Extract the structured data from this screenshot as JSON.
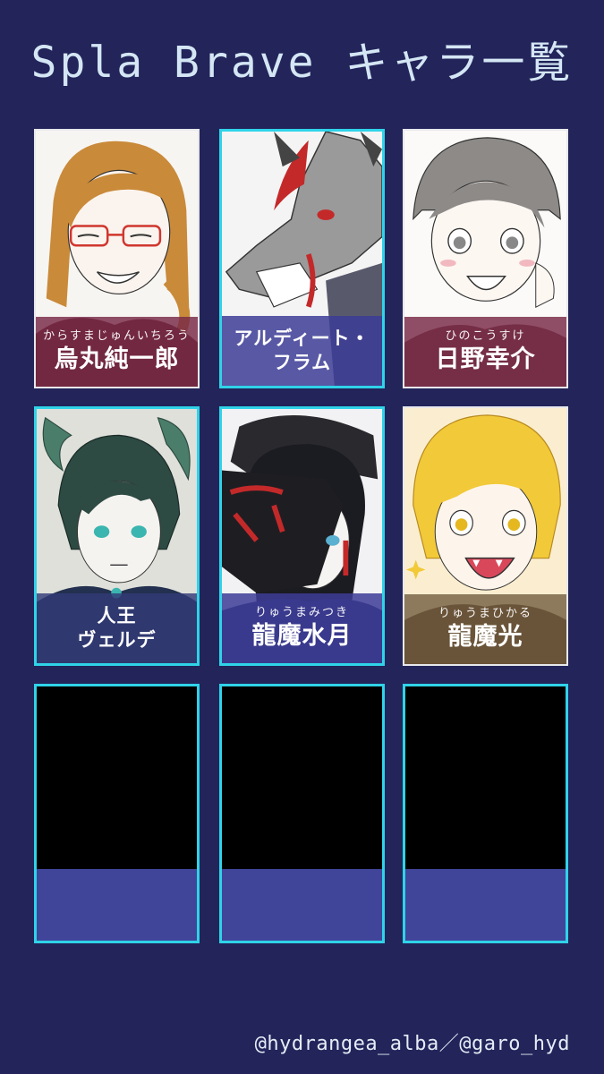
{
  "title": "Spla Brave キャラ一覧",
  "footer": "@hydrangea_alba／@garo_hyd",
  "colors": {
    "background": "#22245a",
    "highlight_border": "#2fd3e8",
    "empty_band": "#40459a"
  },
  "characters": [
    {
      "ruby": "からすまじゅんいちろう",
      "name": "烏丸純一郎",
      "art": "orange-hair-glasses-portrait"
    },
    {
      "ruby": "",
      "name": "アルディート・フラム",
      "name_line1": "アルディート・",
      "name_line2": "フラム",
      "art": "grey-wolf-portrait"
    },
    {
      "ruby": "ひのこうすけ",
      "name": "日野幸介",
      "art": "grey-hair-smiling-portrait"
    },
    {
      "ruby": "",
      "name": "人王ヴェルデ",
      "name_line1": "人王",
      "name_line2": "ヴェルデ",
      "art": "green-horned-portrait"
    },
    {
      "ruby": "りゅうまみつき",
      "name": "龍魔水月",
      "art": "black-hair-hooded-portrait"
    },
    {
      "ruby": "りゅうまひかる",
      "name": "龍魔光",
      "art": "blonde-fanged-portrait"
    }
  ],
  "empty_slots": 3
}
